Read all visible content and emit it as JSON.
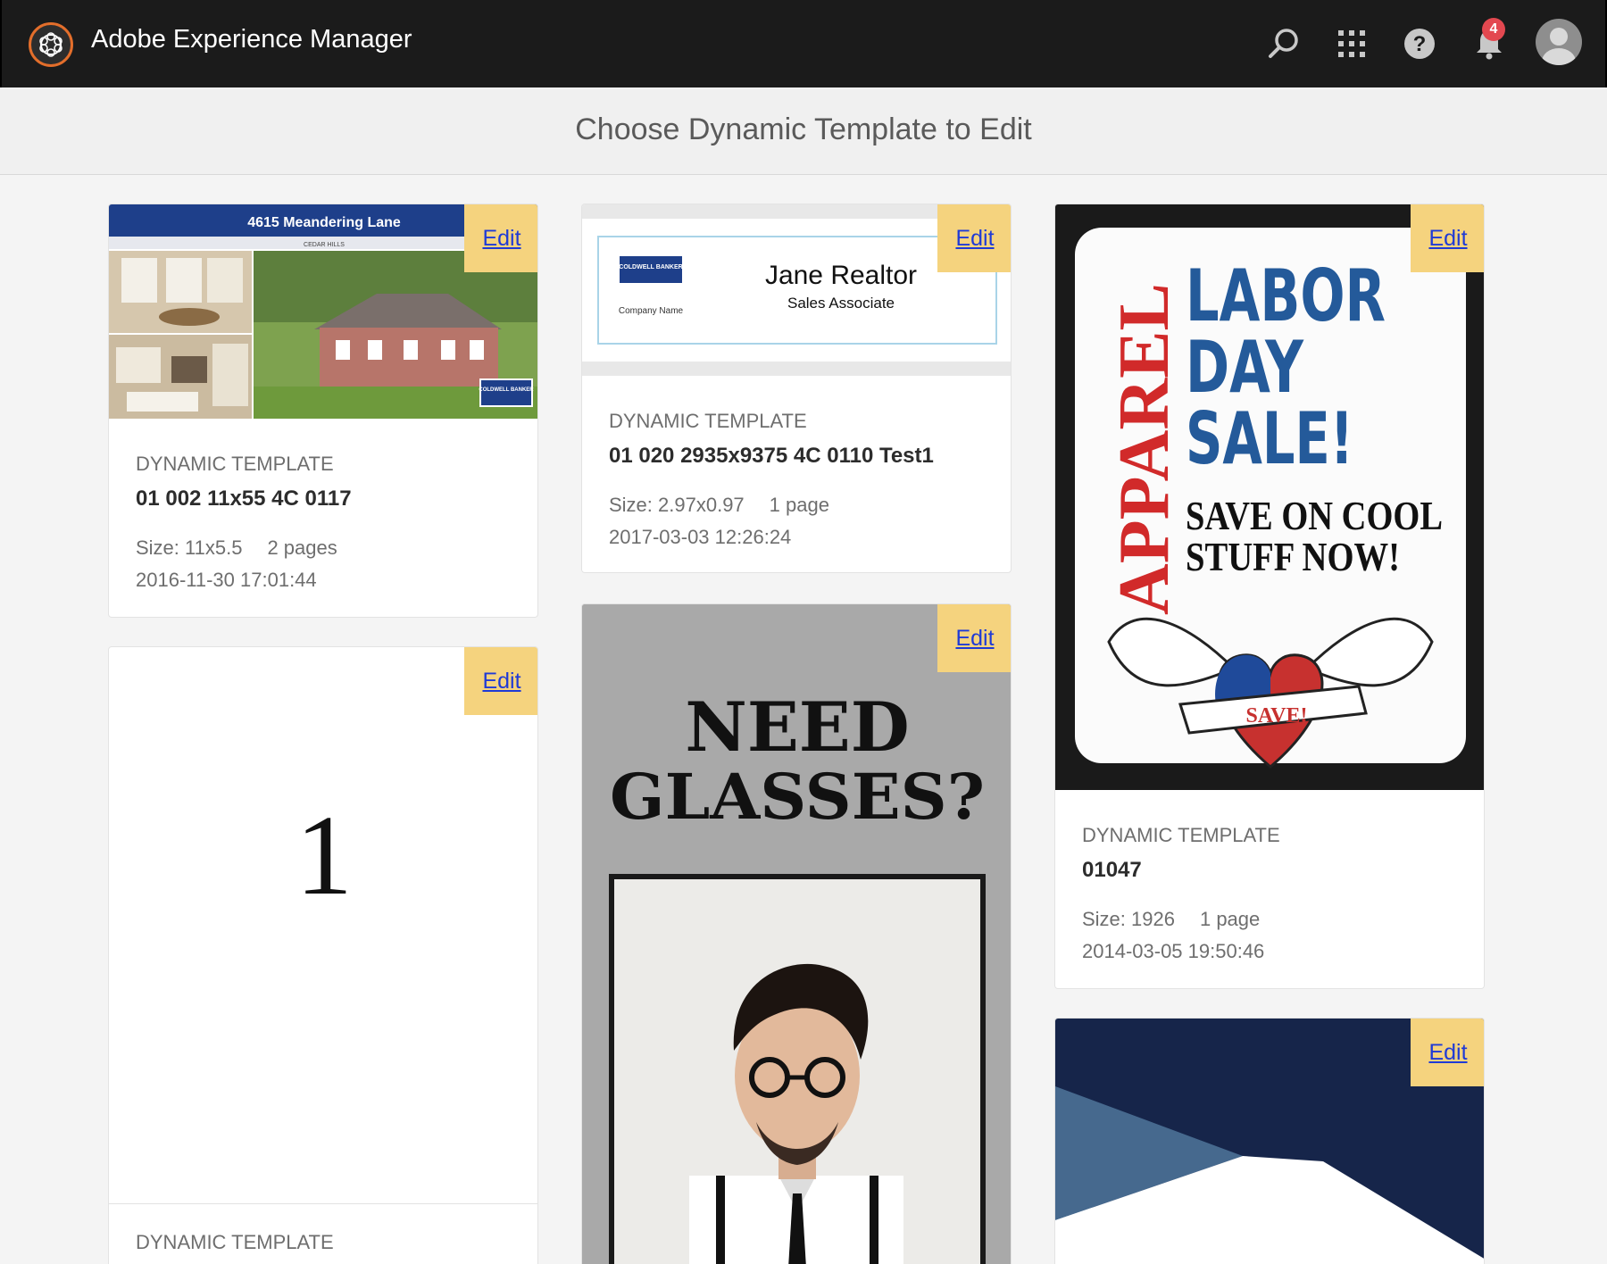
{
  "app": {
    "title": "Adobe Experience Manager",
    "notifications": "4"
  },
  "page": {
    "title": "Choose Dynamic Template to Edit"
  },
  "edit_label": "Edit",
  "cards": [
    {
      "type": "DYNAMIC TEMPLATE",
      "name": "01 002 11x55 4C 0117",
      "size": "Size: 11x5.5",
      "pages": "2 pages",
      "date": "2016-11-30 17:01:44",
      "thumb": {
        "banner": "4615 Meandering Lane",
        "subbanner": "CEDAR HILLS",
        "brand": "COLDWELL BANKER"
      }
    },
    {
      "type": "DYNAMIC TEMPLATE",
      "name": "01 020 2935x9375 4C 0110 Test1",
      "size": "Size: 2.97x0.97",
      "pages": "1 page",
      "date": "2017-03-03 12:26:24",
      "thumb": {
        "brand": "COLDWELL BANKER",
        "company": "Company Name",
        "person": "Jane Realtor",
        "role": "Sales Associate"
      }
    },
    {
      "type": "DYNAMIC TEMPLATE",
      "name": "01047",
      "size": "Size: 1926",
      "pages": "1 page",
      "date": "2014-03-05 19:50:46",
      "thumb": {
        "side": "APPAREL",
        "l1": "LABOR",
        "l2": "DAY",
        "l3": "SALE!",
        "sub1": "SAVE ON COOL",
        "sub2": "STUFF NOW!",
        "ribbon": "SAVE!"
      }
    },
    {
      "type": "DYNAMIC TEMPLATE",
      "thumb": {
        "number": "1"
      }
    },
    {
      "thumb": {
        "h1": "NEED",
        "h2": "GLASSES?"
      }
    },
    {
      "thumb": {}
    }
  ]
}
